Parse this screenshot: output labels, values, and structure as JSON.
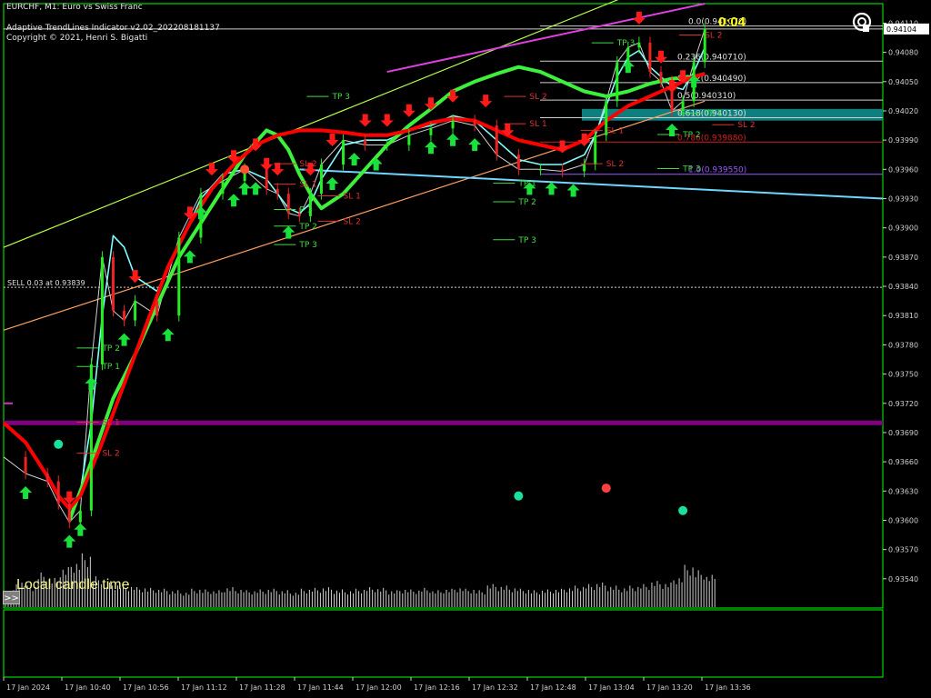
{
  "header": {
    "symbol_line": "EURCHF, M1:  Euro vs Swiss Franc",
    "indicator_name": "Adaptive TrendLines Indicator v2.02_202208181137",
    "copyright": "Copyright © 2021, Henri S. Bigatti"
  },
  "timer": "0:04",
  "local_time_label": "Local candle time",
  "more_button": ">>",
  "logo_icon": "ob-logo-icon",
  "colors": {
    "background": "#000000",
    "axis": "#00ff00",
    "bull_arrow": "#19e03a",
    "bear_arrow": "#ff1a1a",
    "fast_ma": "#7fffff",
    "slow_ma_up": "#3cf03c",
    "slow_ma_down": "#ff0000",
    "fib_zone": "#0d7f7f",
    "purple_line": "#800080"
  },
  "chart_data": {
    "type": "line",
    "price_axis": {
      "range": [
        0.9351,
        0.9413
      ],
      "ticks": [
        0.9411,
        0.9408,
        0.9405,
        0.9402,
        0.9399,
        0.9396,
        0.9393,
        0.939,
        0.9387,
        0.9384,
        0.9381,
        0.9378,
        0.9375,
        0.9372,
        0.9369,
        0.9366,
        0.9363,
        0.936,
        0.9357,
        0.9354
      ],
      "current_price": "0.94104"
    },
    "time_axis": {
      "labels": [
        "17 Jan 2024",
        "17 Jan 10:40",
        "17 Jan 10:56",
        "17 Jan 11:12",
        "17 Jan 11:28",
        "17 Jan 11:44",
        "17 Jan 12:00",
        "17 Jan 12:16",
        "17 Jan 12:32",
        "17 Jan 12:48",
        "17 Jan 13:04",
        "17 Jan 13:20",
        "17 Jan 13:36"
      ]
    },
    "fibonacci": [
      {
        "label": "0.0(0.941070)",
        "price": 0.94107
      },
      {
        "label": "0.236(0.940710)",
        "price": 0.94071
      },
      {
        "label": "0.382(0.940490)",
        "price": 0.94049
      },
      {
        "label": "0.5(0.940310)",
        "price": 0.94031
      },
      {
        "label": "0.618(0.940130)",
        "price": 0.94013
      },
      {
        "label": "0.786(0.939880)",
        "price": 0.93988
      },
      {
        "label": "1.0(0.939550)",
        "price": 0.93955
      }
    ],
    "sell_line": {
      "label": "SELL 0.03 at 0.93839",
      "price": 0.93839
    },
    "trade_labels": [
      {
        "text": "TP 3",
        "price": 0.94032,
        "time": 30,
        "kind": "tp"
      },
      {
        "text": "TP 3",
        "price": 0.94087,
        "time": 56,
        "kind": "tp"
      },
      {
        "text": "SL 2",
        "price": 0.94032,
        "time": 48,
        "kind": "sl"
      },
      {
        "text": "SL 1",
        "price": 0.94004,
        "time": 48,
        "kind": "sl"
      },
      {
        "text": "SL 1",
        "price": 0.93997,
        "time": 55,
        "kind": "sl"
      },
      {
        "text": "SL 2",
        "price": 0.93963,
        "time": 55,
        "kind": "sl"
      },
      {
        "text": "TP 1",
        "price": 0.93943,
        "time": 47,
        "kind": "tp"
      },
      {
        "text": "TP 2",
        "price": 0.93924,
        "time": 47,
        "kind": "tp"
      },
      {
        "text": "TP 3",
        "price": 0.93885,
        "time": 47,
        "kind": "tp"
      },
      {
        "text": "SL 2",
        "price": 0.93963,
        "time": 27,
        "kind": "sl"
      },
      {
        "text": "SL 1",
        "price": 0.93942,
        "time": 27,
        "kind": "sl"
      },
      {
        "text": "SL 1",
        "price": 0.9393,
        "time": 31,
        "kind": "sl"
      },
      {
        "text": "SL 2",
        "price": 0.93904,
        "time": 31,
        "kind": "sl"
      },
      {
        "text": "P 1",
        "price": 0.93916,
        "time": 27,
        "kind": "tp"
      },
      {
        "text": "TP 2",
        "price": 0.93899,
        "time": 27,
        "kind": "tp"
      },
      {
        "text": "TP 3",
        "price": 0.9388,
        "time": 27,
        "kind": "tp"
      },
      {
        "text": "TP 2",
        "price": 0.93774,
        "time": 9,
        "kind": "tp"
      },
      {
        "text": "TP 1",
        "price": 0.93755,
        "time": 9,
        "kind": "tp"
      },
      {
        "text": "SL 1",
        "price": 0.93698,
        "time": 9,
        "kind": "sl"
      },
      {
        "text": "SL 2",
        "price": 0.93666,
        "time": 9,
        "kind": "sl"
      },
      {
        "text": "SL 2",
        "price": 0.94095,
        "time": 64,
        "kind": "sl"
      },
      {
        "text": "TP 1",
        "price": 0.94015,
        "time": 64,
        "kind": "tp"
      },
      {
        "text": "SL 2",
        "price": 0.94003,
        "time": 67,
        "kind": "sl"
      },
      {
        "text": "TP 2",
        "price": 0.93993,
        "time": 62,
        "kind": "tp"
      },
      {
        "text": "TP 3",
        "price": 0.93958,
        "time": 62,
        "kind": "tp"
      }
    ],
    "series": [
      {
        "name": "",
        "role": "close",
        "color": "#cfcfcf",
        "points": [
          [
            0,
            0.93665
          ],
          [
            2,
            0.93648
          ],
          [
            4,
            0.9364
          ],
          [
            5,
            0.93617
          ],
          [
            6,
            0.93598
          ],
          [
            7,
            0.9361
          ],
          [
            8,
            0.9376
          ],
          [
            9,
            0.9387
          ],
          [
            10,
            0.93815
          ],
          [
            11,
            0.93805
          ],
          [
            12,
            0.93825
          ],
          [
            14,
            0.9381
          ],
          [
            16,
            0.9389
          ],
          [
            18,
            0.93935
          ],
          [
            20,
            0.93948
          ],
          [
            22,
            0.9396
          ],
          [
            24,
            0.9394
          ],
          [
            25,
            0.93935
          ],
          [
            26,
            0.93915
          ],
          [
            27,
            0.93912
          ],
          [
            28,
            0.93935
          ],
          [
            29,
            0.93965
          ],
          [
            31,
            0.9399
          ],
          [
            33,
            0.93985
          ],
          [
            35,
            0.93985
          ],
          [
            37,
            0.93995
          ],
          [
            39,
            0.94002
          ],
          [
            41,
            0.9401
          ],
          [
            43,
            0.94005
          ],
          [
            45,
            0.93975
          ],
          [
            47,
            0.9396
          ],
          [
            49,
            0.9396
          ],
          [
            51,
            0.93958
          ],
          [
            53,
            0.93965
          ],
          [
            54,
            0.93995
          ],
          [
            55,
            0.9403
          ],
          [
            56,
            0.9407
          ],
          [
            57,
            0.94085
          ],
          [
            58,
            0.9409
          ],
          [
            59,
            0.9406
          ],
          [
            60,
            0.9405
          ],
          [
            61,
            0.9402
          ],
          [
            62,
            0.9403
          ],
          [
            63,
            0.9407
          ],
          [
            64,
            0.94104
          ]
        ]
      },
      {
        "name": "",
        "role": "fast",
        "color": "#7fffff",
        "points": [
          [
            6,
            0.936
          ],
          [
            7,
            0.9363
          ],
          [
            8,
            0.937
          ],
          [
            9,
            0.9381
          ],
          [
            10,
            0.93892
          ],
          [
            11,
            0.9388
          ],
          [
            12,
            0.9385
          ],
          [
            14,
            0.93835
          ],
          [
            16,
            0.9388
          ],
          [
            18,
            0.9393
          ],
          [
            20,
            0.93955
          ],
          [
            22,
            0.9396
          ],
          [
            24,
            0.9395
          ],
          [
            25,
            0.93935
          ],
          [
            26,
            0.9392
          ],
          [
            27,
            0.93915
          ],
          [
            28,
            0.93925
          ],
          [
            29,
            0.9395
          ],
          [
            31,
            0.93985
          ],
          [
            33,
            0.9399
          ],
          [
            35,
            0.9399
          ],
          [
            37,
            0.94
          ],
          [
            39,
            0.94005
          ],
          [
            41,
            0.94015
          ],
          [
            43,
            0.9401
          ],
          [
            45,
            0.9399
          ],
          [
            47,
            0.9397
          ],
          [
            49,
            0.93965
          ],
          [
            51,
            0.93965
          ],
          [
            53,
            0.93975
          ],
          [
            54,
            0.93995
          ],
          [
            55,
            0.94025
          ],
          [
            56,
            0.94055
          ],
          [
            57,
            0.94075
          ],
          [
            58,
            0.94082
          ],
          [
            59,
            0.94065
          ],
          [
            60,
            0.94055
          ],
          [
            61,
            0.94045
          ],
          [
            62,
            0.94042
          ],
          [
            63,
            0.9406
          ],
          [
            64,
            0.94085
          ]
        ]
      },
      {
        "name": "",
        "role": "slow",
        "color": "#3cf03c",
        "points": [
          [
            6,
            0.936
          ],
          [
            8,
            0.9366
          ],
          [
            10,
            0.93725
          ],
          [
            12,
            0.9377
          ],
          [
            14,
            0.9382
          ],
          [
            16,
            0.9387
          ],
          [
            18,
            0.93905
          ],
          [
            20,
            0.9394
          ],
          [
            22,
            0.93975
          ],
          [
            24,
            0.94
          ],
          [
            25,
            0.93995
          ],
          [
            26,
            0.9398
          ],
          [
            27,
            0.93955
          ],
          [
            28,
            0.93935
          ],
          [
            29,
            0.9392
          ],
          [
            31,
            0.93935
          ],
          [
            33,
            0.9396
          ],
          [
            35,
            0.93985
          ],
          [
            37,
            0.94005
          ],
          [
            39,
            0.94022
          ],
          [
            41,
            0.9404
          ],
          [
            43,
            0.9405
          ],
          [
            45,
            0.94058
          ],
          [
            47,
            0.94065
          ],
          [
            49,
            0.9406
          ],
          [
            51,
            0.9405
          ],
          [
            53,
            0.9404
          ],
          [
            55,
            0.94035
          ],
          [
            57,
            0.9404
          ],
          [
            59,
            0.94048
          ],
          [
            61,
            0.94053
          ],
          [
            63,
            0.94055
          ],
          [
            64,
            0.94058
          ]
        ]
      },
      {
        "name": "",
        "role": "trend-red",
        "color": "#ff0000",
        "points": [
          [
            0,
            0.937
          ],
          [
            2,
            0.9368
          ],
          [
            4,
            0.93645
          ],
          [
            5,
            0.93625
          ],
          [
            6,
            0.93612
          ],
          [
            7,
            0.93625
          ],
          [
            9,
            0.9368
          ],
          [
            11,
            0.9374
          ],
          [
            13,
            0.938
          ],
          [
            15,
            0.9386
          ],
          [
            17,
            0.93905
          ],
          [
            19,
            0.9394
          ],
          [
            21,
            0.93965
          ],
          [
            23,
            0.93985
          ],
          [
            25,
            0.93995
          ],
          [
            27,
            0.94
          ],
          [
            29,
            0.94
          ],
          [
            31,
            0.93998
          ],
          [
            33,
            0.93995
          ],
          [
            35,
            0.93995
          ],
          [
            37,
            0.94
          ],
          [
            39,
            0.94008
          ],
          [
            41,
            0.94012
          ],
          [
            43,
            0.9401
          ],
          [
            45,
            0.94
          ],
          [
            47,
            0.9399
          ],
          [
            49,
            0.93985
          ],
          [
            51,
            0.9398
          ],
          [
            53,
            0.9399
          ],
          [
            55,
            0.9401
          ],
          [
            57,
            0.94025
          ],
          [
            59,
            0.94035
          ],
          [
            61,
            0.94045
          ],
          [
            63,
            0.94055
          ],
          [
            64,
            0.94058
          ]
        ]
      }
    ],
    "channel": {
      "upper": [
        [
          0,
          0.9388
        ],
        [
          64,
          0.9417
        ]
      ],
      "lower": [
        [
          0,
          0.93795
        ],
        [
          64,
          0.9403
        ]
      ],
      "support": [
        [
          27,
          0.9396
        ],
        [
          66,
          0.9393
        ]
      ],
      "purple_high": [
        [
          35,
          0.9406
        ],
        [
          64,
          0.9413
        ]
      ]
    },
    "signals": {
      "buy_arrows": [
        2,
        6,
        7,
        8,
        11,
        15,
        17,
        18,
        21,
        22,
        23,
        26,
        30,
        32,
        34,
        39,
        41,
        43,
        48,
        50,
        52,
        57,
        61,
        63
      ],
      "sell_arrows": [
        6,
        12,
        17,
        19,
        21,
        23,
        24,
        25,
        28,
        30,
        33,
        35,
        37,
        39,
        41,
        44,
        46,
        51,
        53,
        58,
        60,
        61,
        62
      ]
    },
    "dots": [
      {
        "time": 5,
        "price": 0.93678,
        "color": "#19e0a0"
      },
      {
        "time": 22,
        "price": 0.9396,
        "color": "#ff5030"
      },
      {
        "time": 47,
        "price": 0.93625,
        "color": "#19e0a0"
      },
      {
        "time": 55,
        "price": 0.93633,
        "color": "#ff4040"
      },
      {
        "time": 62,
        "price": 0.9361,
        "color": "#19e0a0"
      }
    ],
    "volume": [
      22,
      34,
      28,
      45,
      38,
      52,
      60,
      70,
      40,
      32,
      30,
      28,
      26,
      25,
      24,
      22,
      20,
      24,
      23,
      22,
      26,
      24,
      22,
      23,
      24,
      22,
      20,
      24,
      25,
      26,
      23,
      22,
      24,
      26,
      25,
      22,
      24,
      23,
      25,
      22,
      24,
      26,
      24,
      22,
      30,
      28,
      26,
      24,
      22,
      23,
      24,
      26,
      28,
      30,
      32,
      28,
      26,
      28,
      30,
      34,
      32,
      40,
      55,
      48,
      42
    ],
    "hlines": {
      "purple_level": 0.937,
      "sell_level": 0.93839
    }
  }
}
